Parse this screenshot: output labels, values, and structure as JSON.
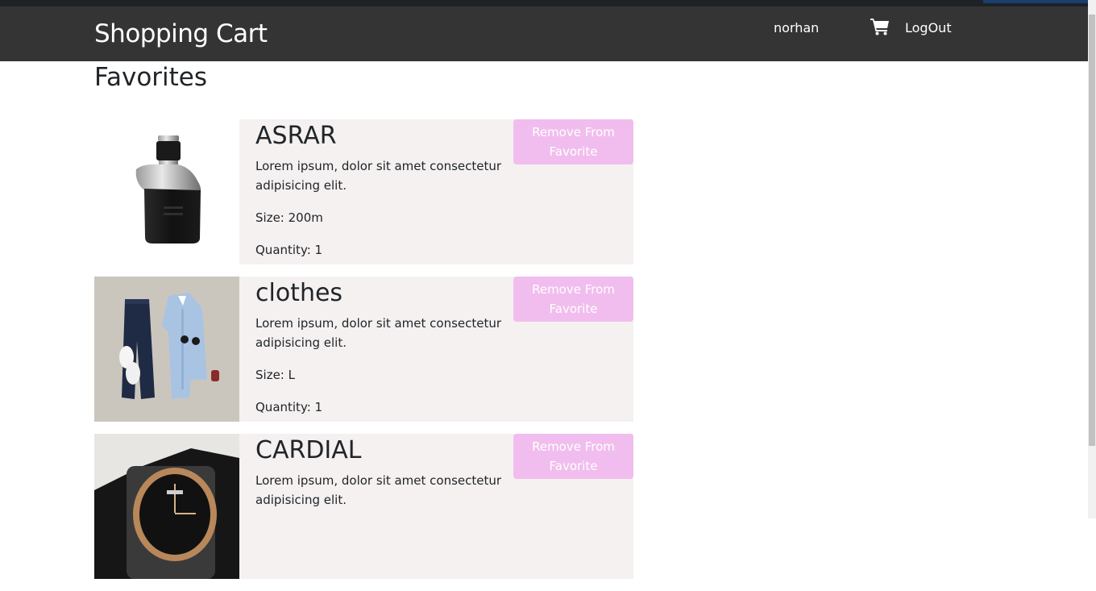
{
  "navbar": {
    "brand": "Shopping Cart",
    "user": "norhan",
    "cart_icon": "shopping-cart-icon",
    "logout": "LogOut"
  },
  "page": {
    "title": "Favorites"
  },
  "favorites": [
    {
      "name": "ASRAR",
      "description": "Lorem ipsum, dolor sit amet consectetur adipisicing elit.",
      "size": "Size: 200m",
      "quantity": "Quantity: 1",
      "remove_label": "Remove From Favorite"
    },
    {
      "name": "clothes",
      "description": "Lorem ipsum, dolor sit amet consectetur adipisicing elit.",
      "size": "Size: L",
      "quantity": "Quantity: 1",
      "remove_label": "Remove From Favorite"
    },
    {
      "name": "CARDIAL",
      "description": "Lorem ipsum, dolor sit amet consectetur adipisicing elit.",
      "size": "",
      "quantity": "",
      "remove_label": "Remove From Favorite"
    }
  ],
  "colors": {
    "navbar_bg": "#343434",
    "card_bg": "#f5f1f1",
    "button_bg": "#f1bdee"
  }
}
